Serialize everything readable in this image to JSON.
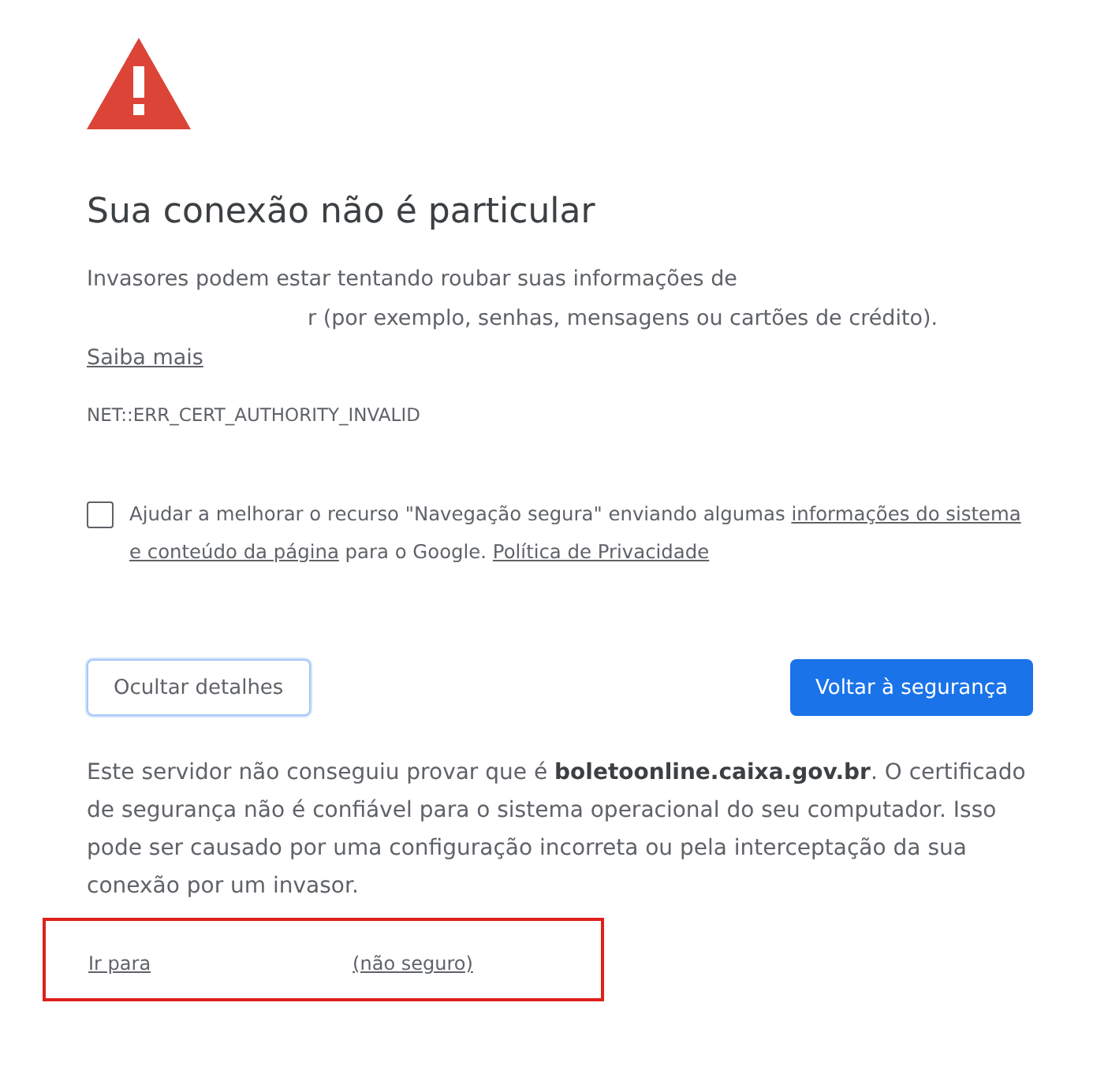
{
  "heading": "Sua conexão não é particular",
  "intro": {
    "line1": "Invasores podem estar tentando roubar suas informações de",
    "line2_tail": "r (por exemplo, senhas, mensagens ou cartões de crédito).",
    "learn_more": "Saiba mais"
  },
  "error_code": "NET::ERR_CERT_AUTHORITY_INVALID",
  "opt_in": {
    "checked": false,
    "text_before": "Ajudar a melhorar o recurso \"Navegação segura\" enviando algumas",
    "link_parts": [
      "informações do sistema",
      "e conteúdo da página"
    ],
    "text_after": "para o Google.",
    "privacy_link": "Política de Privacidade"
  },
  "buttons": {
    "details": "Ocultar detalhes",
    "back": "Voltar à segurança"
  },
  "details_text": "Este servidor não conseguiu provar que é **boletoonline.caixa.gov.br**. O certificado de segurança não é confiável para o sistema operacional do seu computador. Isso pode ser causado por uma configuração incorreta ou pela interceptação da sua conexão por um invasor.",
  "proceed_link": {
    "before": "Ir para",
    "after": "(não seguro)",
    "highlighted": true
  }
}
